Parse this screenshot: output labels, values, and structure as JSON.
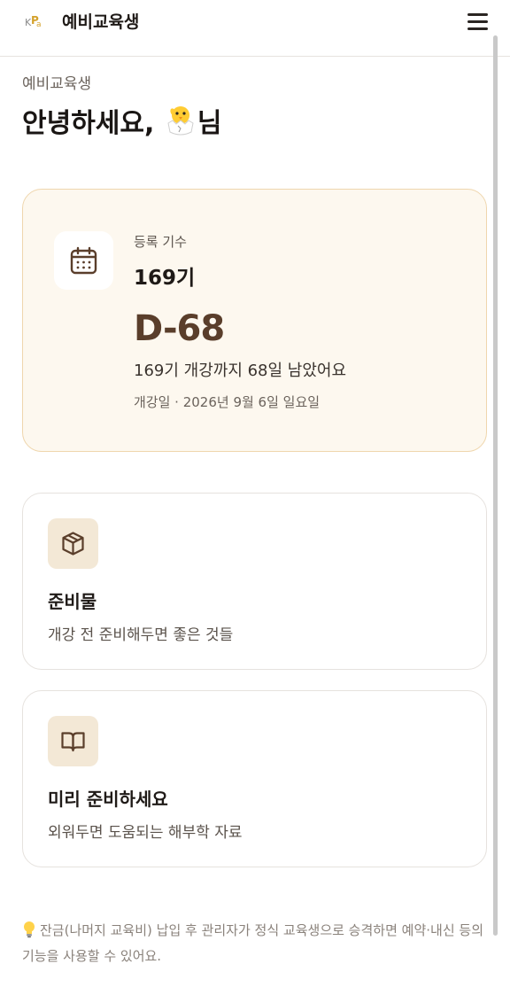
{
  "header": {
    "title": "예비교육생",
    "logo_icon": "kpa-logo",
    "menu_icon": "hamburger-menu-icon"
  },
  "greeting": {
    "role": "예비교육생",
    "prefix": "안녕하세요, ",
    "name_icon": "hatching-chick-emoji",
    "suffix": "님"
  },
  "dday_card": {
    "icon": "calendar-icon",
    "batch_label": "등록 기수",
    "batch_value": "169기",
    "dday": "D-68",
    "remaining_text": "169기 개강까지 68일 남았어요",
    "open_date_text": "개강일 · 2026년 9월 6일 일요일"
  },
  "cards": [
    {
      "icon": "package-box-icon",
      "title": "준비물",
      "desc": "개강 전 준비해두면 좋은 것들"
    },
    {
      "icon": "open-book-icon",
      "title": "미리 준비하세요",
      "desc": "외워두면 도움되는 해부학 자료"
    }
  ],
  "notice": {
    "icon": "lightbulb-icon",
    "text": "잔금(나머지 교육비) 납입 후 관리자가 정식 교육생으로 승격하면 예약·내신 등의 기능을 사용할 수 있어요."
  },
  "colors": {
    "accent_brown": "#5a3e2b",
    "card_bg": "#fdf8ef",
    "card_border": "#efd6ad",
    "icon_box_bg": "#f3e8d6"
  }
}
